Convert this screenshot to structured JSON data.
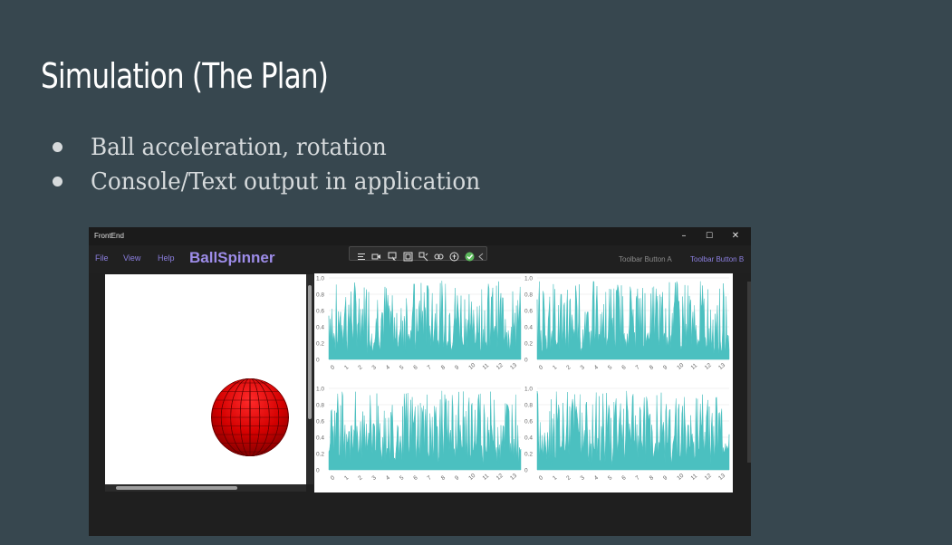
{
  "slide": {
    "title": "Simulation (The Plan)",
    "bullets": [
      "Ball acceleration, rotation",
      "Console/Text output in application"
    ]
  },
  "window": {
    "title": "FrontEnd",
    "minimize": "–",
    "maximize": "☐",
    "close": "✕",
    "menu": [
      "File",
      "View",
      "Help"
    ],
    "brand": "BallSpinner",
    "toolbar_a": "Toolbar Button A",
    "toolbar_b": "Toolbar Button B",
    "colors": {
      "accent": "#9d8ce8",
      "ball": "#cc0000",
      "series": "#4bc0c0"
    },
    "dev_toolbar_icons": [
      "live-tree-icon",
      "camera-icon",
      "select-element-icon",
      "display-layout-icon",
      "track-focus-icon",
      "binding-failures-icon",
      "accessibility-icon",
      "check-icon",
      "collapse-icon"
    ]
  },
  "chart_data": [
    {
      "type": "area",
      "x": [
        0,
        1,
        2,
        3,
        4,
        5,
        6,
        7,
        8,
        9,
        10,
        11,
        12,
        13
      ],
      "ylim": [
        0,
        1.0
      ],
      "yticks": [
        "0",
        "0.2",
        "0.4",
        "0.6",
        "0.8",
        "1.0"
      ],
      "series": [
        {
          "color": "#4bc0c0",
          "note": "dense noisy signal, mostly 0.1–0.95"
        }
      ]
    },
    {
      "type": "area",
      "x": [
        0,
        1,
        2,
        3,
        4,
        5,
        6,
        7,
        8,
        9,
        10,
        11,
        12,
        13
      ],
      "ylim": [
        0,
        1.0
      ],
      "yticks": [
        "0",
        "0.2",
        "0.4",
        "0.6",
        "0.8",
        "1.0"
      ],
      "series": [
        {
          "color": "#4bc0c0"
        }
      ]
    },
    {
      "type": "area",
      "x": [
        0,
        1,
        2,
        3,
        4,
        5,
        6,
        7,
        8,
        9,
        10,
        11,
        12,
        13
      ],
      "ylim": [
        0,
        1.0
      ],
      "yticks": [
        "0",
        "0.2",
        "0.4",
        "0.6",
        "0.8",
        "1.0"
      ],
      "series": [
        {
          "color": "#4bc0c0"
        }
      ]
    },
    {
      "type": "area",
      "x": [
        0,
        1,
        2,
        3,
        4,
        5,
        6,
        7,
        8,
        9,
        10,
        11,
        12,
        13
      ],
      "ylim": [
        0,
        1.0
      ],
      "yticks": [
        "0",
        "0.2",
        "0.4",
        "0.6",
        "0.8",
        "1.0"
      ],
      "series": [
        {
          "color": "#4bc0c0"
        }
      ]
    }
  ]
}
